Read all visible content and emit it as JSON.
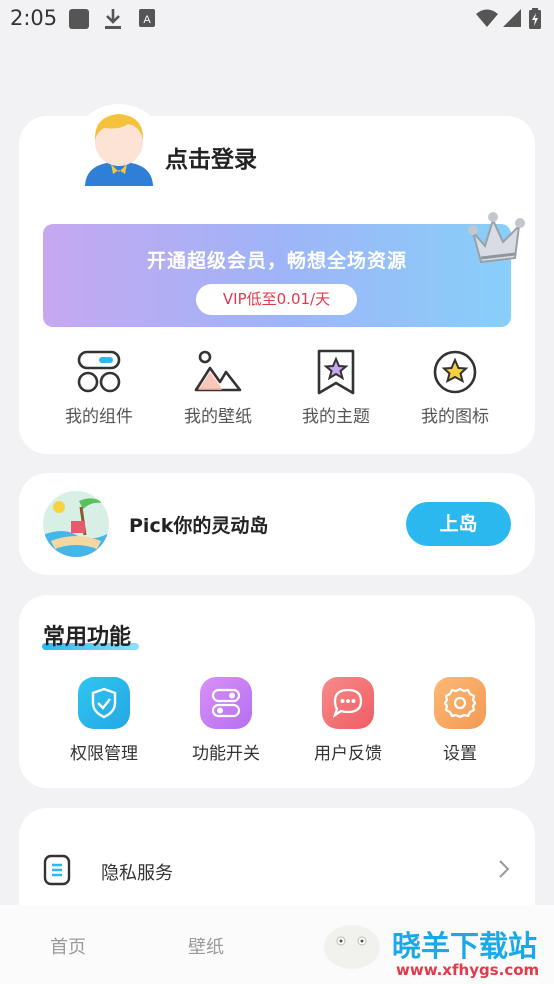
{
  "status_bar": {
    "time": "2:05"
  },
  "profile": {
    "login_text": "点击登录"
  },
  "vip": {
    "title": "开通超级会员，畅想全场资源",
    "pill": "VIP低至0.01/天"
  },
  "quick_links": [
    {
      "label": "我的组件",
      "icon": "widgets-icon"
    },
    {
      "label": "我的壁纸",
      "icon": "wallpaper-icon"
    },
    {
      "label": "我的主题",
      "icon": "theme-icon"
    },
    {
      "label": "我的图标",
      "icon": "icon-pack-icon"
    }
  ],
  "island": {
    "text": "Pick你的灵动岛",
    "button": "上岛"
  },
  "common": {
    "title": "常用功能",
    "items": [
      {
        "label": "权限管理",
        "icon": "shield-icon",
        "color": "#28b8ea"
      },
      {
        "label": "功能开关",
        "icon": "toggle-icon",
        "color": "#c57ef2"
      },
      {
        "label": "用户反馈",
        "icon": "chat-icon",
        "color": "#f26a6a"
      },
      {
        "label": "设置",
        "icon": "gear-icon",
        "color": "#f6a05a"
      }
    ]
  },
  "privacy": {
    "label": "隐私服务"
  },
  "bottom_nav": {
    "home": "首页",
    "wallpaper": "壁纸",
    "watermark": "晓羊下载站",
    "watermark_url": "www.xfhygs.com"
  },
  "colors": {
    "accent": "#2ab8ef",
    "vip_price": "#e2384f"
  }
}
